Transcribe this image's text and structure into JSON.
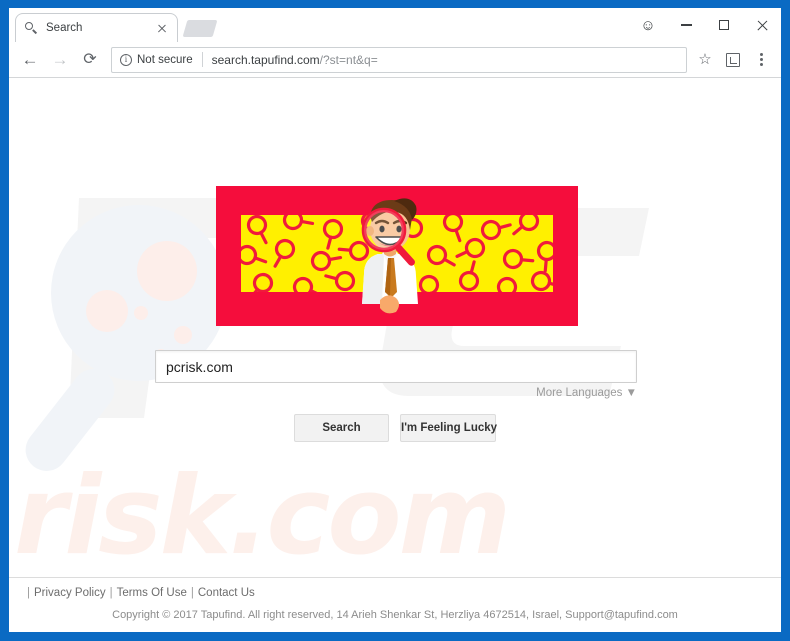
{
  "browser": {
    "tab": {
      "title": "Search",
      "favicon": "magnifier-icon",
      "close_label": "×"
    },
    "new_tab_label": "+",
    "window_controls": {
      "profile": "profile-icon",
      "minimize": "minimize-icon",
      "maximize": "maximize-icon",
      "close": "close-icon"
    },
    "toolbar": {
      "back": "←",
      "forward": "→",
      "reload": "⟳",
      "security_label": "Not secure",
      "url_host": "search.tapufind.com",
      "url_path": "/?st=nt&q=",
      "bookmark": "☆",
      "extension": "extension-icon",
      "menu": "menu-icon"
    }
  },
  "page": {
    "banner": {
      "border_color": "#f50d3c",
      "inner_color": "#fff000",
      "pattern": "magnifier-glass-tile",
      "character": "cartoon-man-with-magnifier"
    },
    "watermarks": {
      "risk_text": "risk.com",
      "magnifier": "magnifier-watermark",
      "pc_letters": "pc-letters-watermark"
    },
    "search": {
      "value": "pcrisk.com",
      "placeholder": "",
      "more_languages_label": "More Languages ▼",
      "search_button_label": "Search",
      "lucky_button_label": "I'm Feeling Lucky"
    },
    "footer": {
      "leading_separator": "|",
      "links": [
        {
          "label": "Privacy Policy"
        },
        {
          "label": "Terms Of Use"
        },
        {
          "label": "Contact Us"
        }
      ],
      "separator": "|",
      "copyright": "Copyright © 2017 Tapufind. All right reserved, 14 Arieh Shenkar St, Herzliya 4672514, Israel, Support@tapufind.com"
    }
  },
  "colors": {
    "window_border": "#0a6ac3",
    "banner_red": "#f50d3c",
    "banner_yellow": "#fff000",
    "watermark_pink": "#fdf0eb"
  }
}
